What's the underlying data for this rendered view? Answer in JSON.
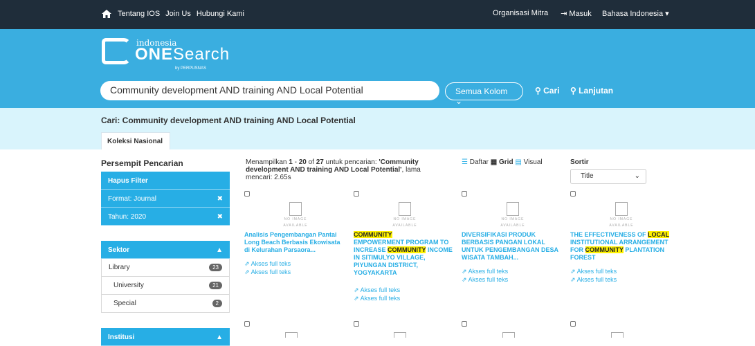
{
  "topnav": {
    "home_label": "Tentang IOS",
    "join": "Join Us",
    "contact": "Hubungi Kami",
    "mitra": "Organisasi Mitra",
    "masuk": "Masuk",
    "language": "Bahasa Indonesia"
  },
  "logo": {
    "top": "indonesia",
    "main_bold": "ONE",
    "main_light": "Search",
    "sub": "by PERPUSNAS"
  },
  "search": {
    "value": "Community development AND training AND Local Potential",
    "column": "Semua Kolom",
    "search_btn": "Cari",
    "advanced": "Lanjutan"
  },
  "query_label": "Cari: Community development AND training AND Local Potential",
  "tab": "Koleksi Nasional",
  "sidebar": {
    "heading": "Persempit Pencarian",
    "clear": "Hapus Filter",
    "filters": [
      "Format: Journal",
      "Tahun: 2020"
    ],
    "sektor": {
      "title": "Sektor",
      "items": [
        {
          "label": "Library",
          "count": "23"
        },
        {
          "label": "University",
          "count": "21"
        },
        {
          "label": "Special",
          "count": "2"
        }
      ]
    },
    "institusi": "Institusi"
  },
  "results": {
    "p1": "Menampilkan ",
    "from": "1",
    "dash": " - ",
    "to": "20",
    "of": " of ",
    "total": "27",
    "p2": " untuk pencarian: ",
    "query": "'Community development AND training AND Local Potential'",
    "p3": ", lama mencari: 2.65s"
  },
  "views": {
    "daftar": "Daftar",
    "grid": "Grid",
    "visual": "Visual"
  },
  "sort": {
    "label": "Sortir",
    "value": "Title"
  },
  "no_image": [
    "NO IMAGE",
    "AVAILABLE"
  ],
  "link_label": "Akses full teks",
  "cards": [
    {
      "title": "Analisis Pengembangan Pantai Long Beach Berbasis Ekowisata di Kelurahan Parsaora...",
      "links": 2
    },
    {
      "title": "COMMUNITY EMPOWERMENT PROGRAM TO INCREASE COMMUNITY INCOME IN SITIMULYO VILLAGE, PIYUNGAN DISTRICT, YOGYAKARTA",
      "links": 2
    },
    {
      "title": "DIVERSIFIKASI PRODUK BERBASIS PANGAN LOKAL UNTUK PENGEMBANGAN DESA WISATA TAMBAH...",
      "links": 2
    },
    {
      "title": "THE EFFECTIVENESS OF LOCAL INSTITUTIONAL ARRANGEMENT FOR COMMUNITY PLANTATION FOREST",
      "links": 2
    }
  ],
  "colors": {
    "nav": "#1f2d3a",
    "accent": "#27aee5",
    "highlight": "#fff200",
    "band": "#d9f4fc"
  }
}
